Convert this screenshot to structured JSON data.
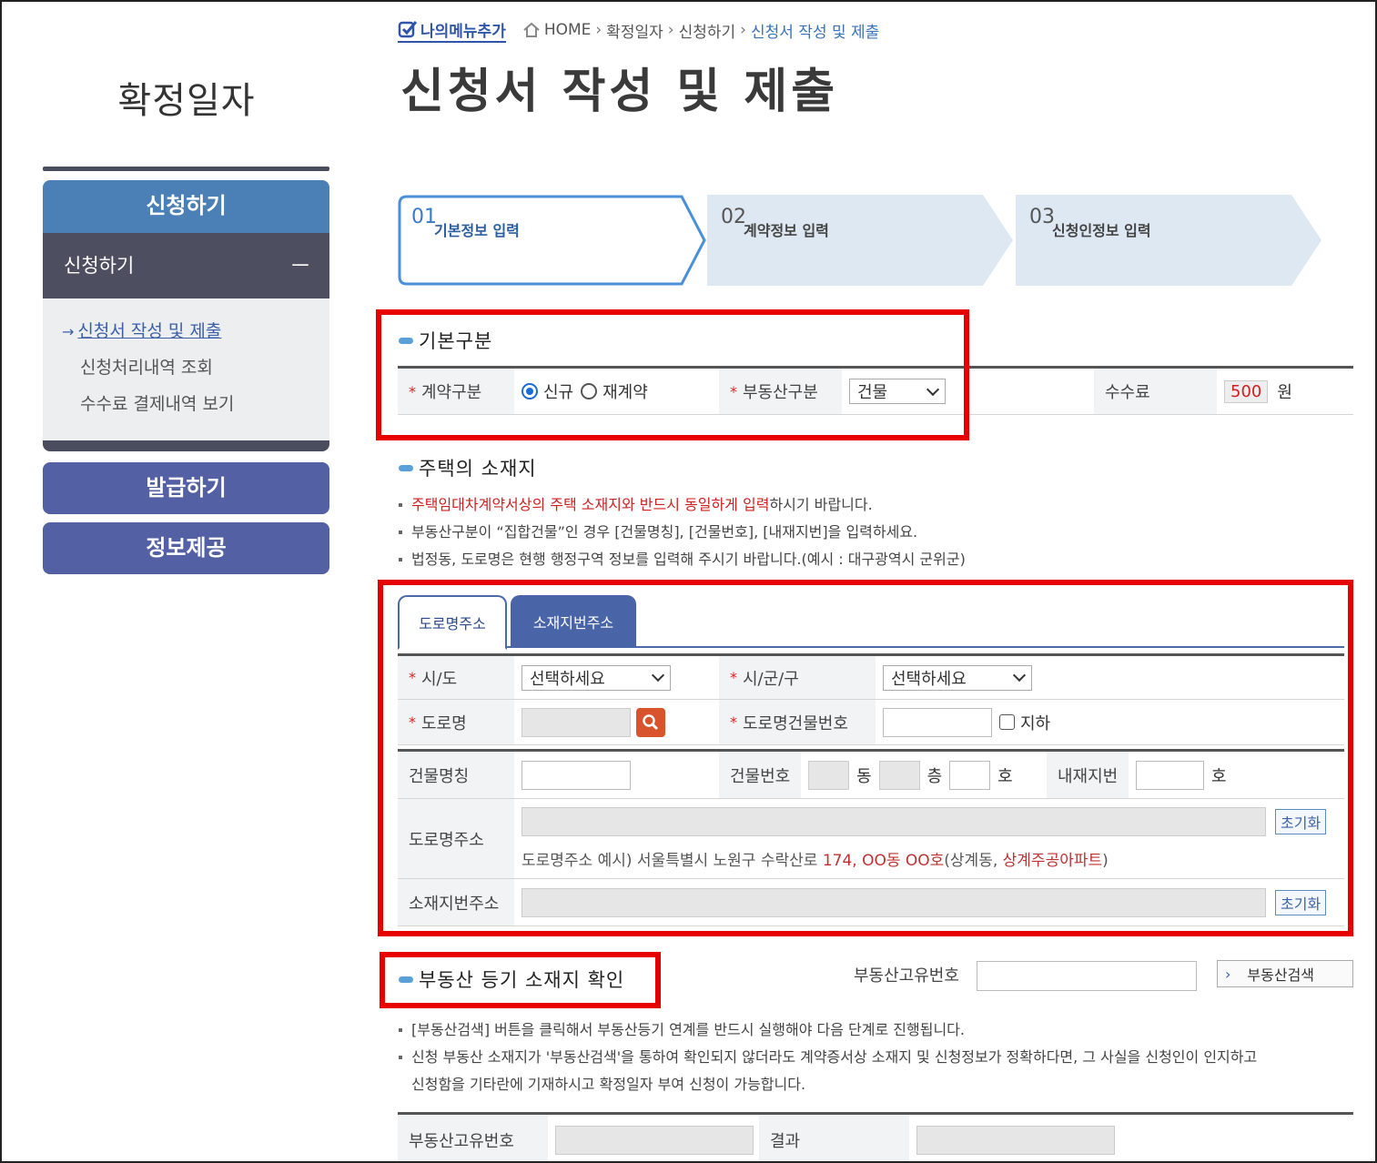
{
  "side": {
    "title": "확정일자",
    "menu_apply": "신청하기",
    "sub_apply": "신청하기",
    "sub_toggle": "－",
    "links": [
      "신청서 작성 및 제출",
      "신청처리내역 조회",
      "수수료 결제내역 보기"
    ],
    "menu_issue": "발급하기",
    "menu_info": "정보제공"
  },
  "header": {
    "mymenu": "나의메뉴추가",
    "crumbs": [
      "HOME",
      "확정일자",
      "신청하기",
      "신청서 작성 및 제출"
    ],
    "title": "신청서 작성 및 제출"
  },
  "steps": [
    {
      "num": "01",
      "label": "기본정보 입력"
    },
    {
      "num": "02",
      "label": "계약정보 입력"
    },
    {
      "num": "03",
      "label": "신청인정보 입력"
    }
  ],
  "basic": {
    "title": "기본구분",
    "contract_label": "계약구분",
    "opt_new": "신규",
    "opt_renew": "재계약",
    "property_label": "부동산구분",
    "property_value": "건물",
    "fee_label": "수수료",
    "fee_value": "500",
    "fee_unit": "원"
  },
  "location": {
    "title": "주택의 소재지",
    "note1_red": "주택임대차계약서상의 주택 소재지와 반드시 동일하게 입력",
    "note1_rest": "하시기 바랍니다.",
    "note2": "부동산구분이 “집합건물”인 경우 [건물명칭], [건물번호], [내재지번]을 입력하세요.",
    "note3": "법정동, 도로명은 현행 행정구역 정보를 입력해 주시기 바랍니다.(예시 : 대구광역시 군위군)",
    "tab_road": "도로명주소",
    "tab_lot": "소재지번주소",
    "sido_label": "시/도",
    "sido_value": "선택하세요",
    "sigungu_label": "시/군/구",
    "sigungu_value": "선택하세요",
    "road_label": "도로명",
    "road_no_label": "도로명건물번호",
    "underground": "지하",
    "bldg_name_label": "건물명칭",
    "bldg_no_label": "건물번호",
    "dong": "동",
    "floor": "층",
    "ho": "호",
    "inner_label": "내재지번",
    "inner_ho": "호",
    "road_addr_label": "도로명주소",
    "reset": "초기화",
    "example_prefix": "도로명주소 예시) 서울특별시 노원구 수락산로 ",
    "example_red1": "174, OO동 OO호",
    "example_mid": "(상계동, ",
    "example_red2": "상계주공아파트",
    "example_end": ")",
    "lot_addr_label": "소재지번주소"
  },
  "registry": {
    "title": "부동산 등기 소재지 확인",
    "uid_label": "부동산고유번호",
    "search_button": "부동산검색",
    "note1": "[부동산검색] 버튼을 클릭해서 부동산등기 연계를 반드시 실행해야 다음 단계로 진행됩니다.",
    "note2a": "신청 부동산 소재지가 '부동산검색'을 통하여 확인되지 않더라도 계약증서상 소재지 및 신청정보가 정확하다면, 그 사실을 신청인이 인지하고",
    "note2b": "신청함을 기타란에 기재하시고 확정일자 부여 신청이 가능합니다.",
    "uid_col": "부동산고유번호",
    "result_col": "결과"
  },
  "colors": {
    "accent": "#4a80b5",
    "highlight": "#e60000",
    "nav": "#5360a3"
  }
}
